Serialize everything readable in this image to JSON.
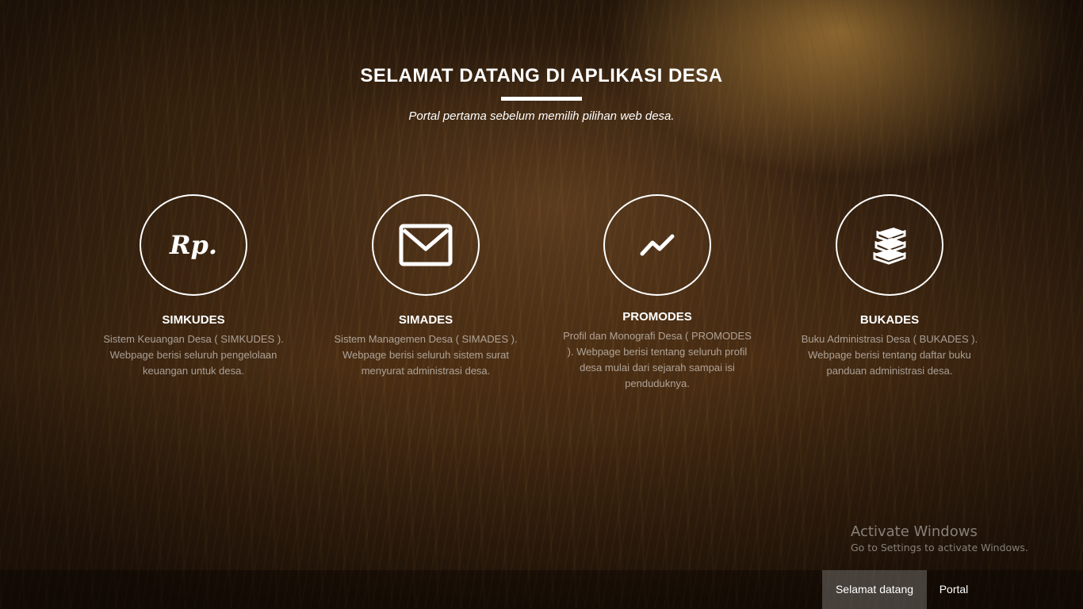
{
  "header": {
    "title": "SELAMAT DATANG DI APLIKASI DESA",
    "subtitle": "Portal pertama sebelum memilih pilihan web desa."
  },
  "services": [
    {
      "icon": "rupiah-icon",
      "icon_text": "Rp.",
      "name": "SIMKUDES",
      "description": "Sistem Keuangan Desa ( SIMKUDES ). Webpage berisi seluruh pengelolaan keuangan untuk desa."
    },
    {
      "icon": "envelope-icon",
      "name": "SIMADES",
      "description": "Sistem Managemen Desa ( SIMADES ). Webpage berisi seluruh sistem surat menyurat administrasi desa."
    },
    {
      "icon": "line-chart-icon",
      "name": "PROMODES",
      "description": "Profil dan Monografi Desa ( PROMODES ). Webpage berisi tentang seluruh profil desa mulai dari sejarah sampai isi penduduknya."
    },
    {
      "icon": "books-icon",
      "name": "BUKADES",
      "description": "Buku Administrasi Desa ( BUKADES ). Webpage berisi tentang daftar buku panduan administrasi desa."
    }
  ],
  "nav": {
    "items": [
      {
        "label": "Selamat datang",
        "active": true
      },
      {
        "label": "Portal",
        "active": false
      }
    ]
  },
  "watermark": {
    "title": "Activate Windows",
    "subtitle": "Go to Settings to activate Windows."
  }
}
